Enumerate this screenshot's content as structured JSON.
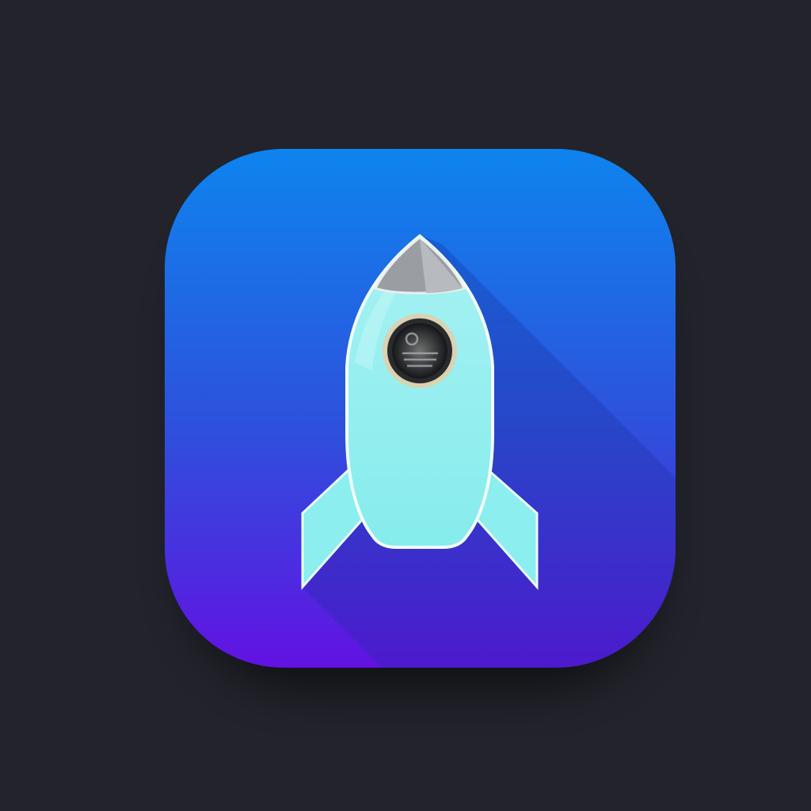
{
  "background": "#22232b",
  "app_icon": {
    "symbol": "rocket-icon",
    "gradient_top": "#0e84ee",
    "gradient_bottom": "#6212e2",
    "rocket_body": "#8ef0ee",
    "rocket_nose": "#9a9ea3",
    "porthole_ring": "#d9d2b3"
  }
}
